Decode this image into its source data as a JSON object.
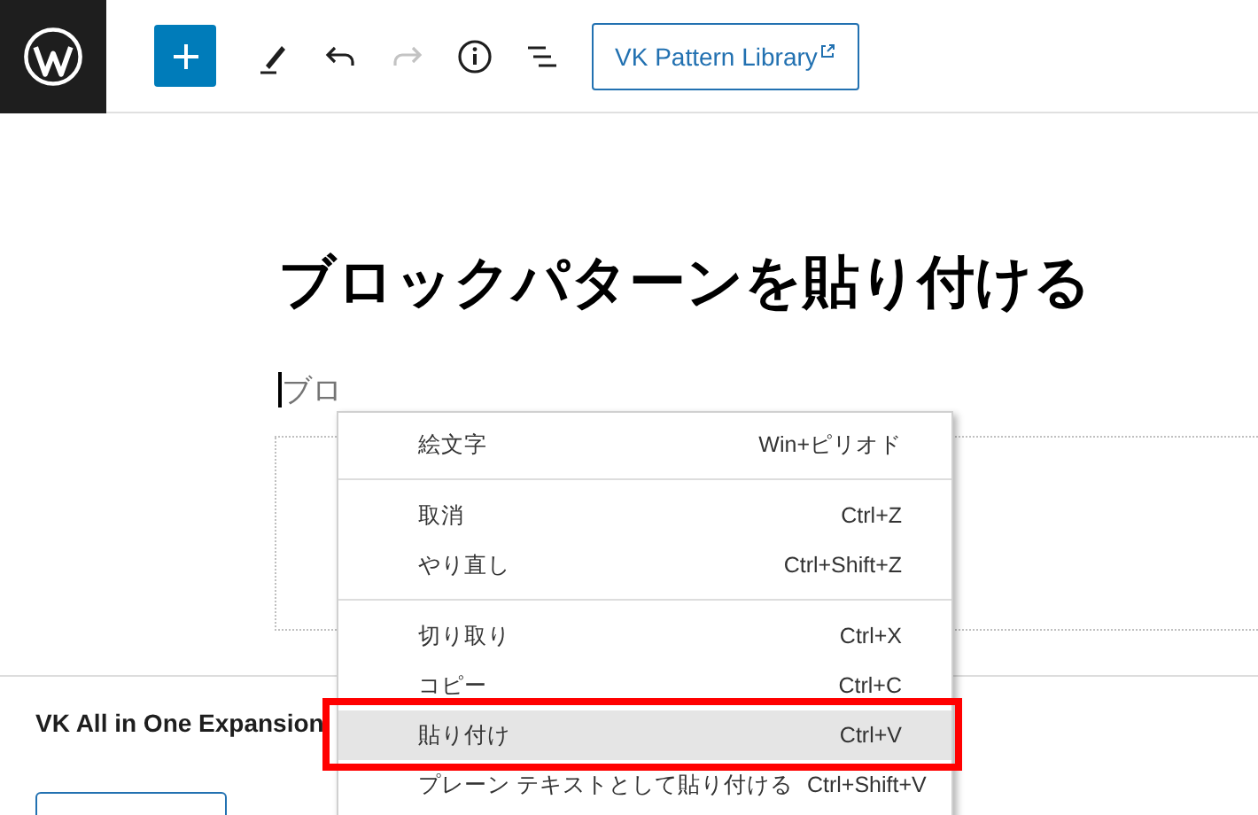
{
  "toolbar": {
    "library_button": "VK Pattern Library",
    "redo_disabled": true
  },
  "editor": {
    "title": "ブロックパターンを貼り付ける",
    "placeholder": "ブロ"
  },
  "panel": {
    "heading": "VK All in One Expansion"
  },
  "context_menu": {
    "groups": [
      [
        {
          "label": "絵文字",
          "shortcut": "Win+ピリオド",
          "highlighted": false
        }
      ],
      [
        {
          "label": "取消",
          "shortcut": "Ctrl+Z",
          "highlighted": false
        },
        {
          "label": "やり直し",
          "shortcut": "Ctrl+Shift+Z",
          "highlighted": false
        }
      ],
      [
        {
          "label": "切り取り",
          "shortcut": "Ctrl+X",
          "highlighted": false
        },
        {
          "label": "コピー",
          "shortcut": "Ctrl+C",
          "highlighted": false
        },
        {
          "label": "貼り付け",
          "shortcut": "Ctrl+V",
          "highlighted": true
        },
        {
          "label": "プレーン テキストとして貼り付ける",
          "shortcut": "Ctrl+Shift+V",
          "highlighted": false
        }
      ]
    ]
  }
}
